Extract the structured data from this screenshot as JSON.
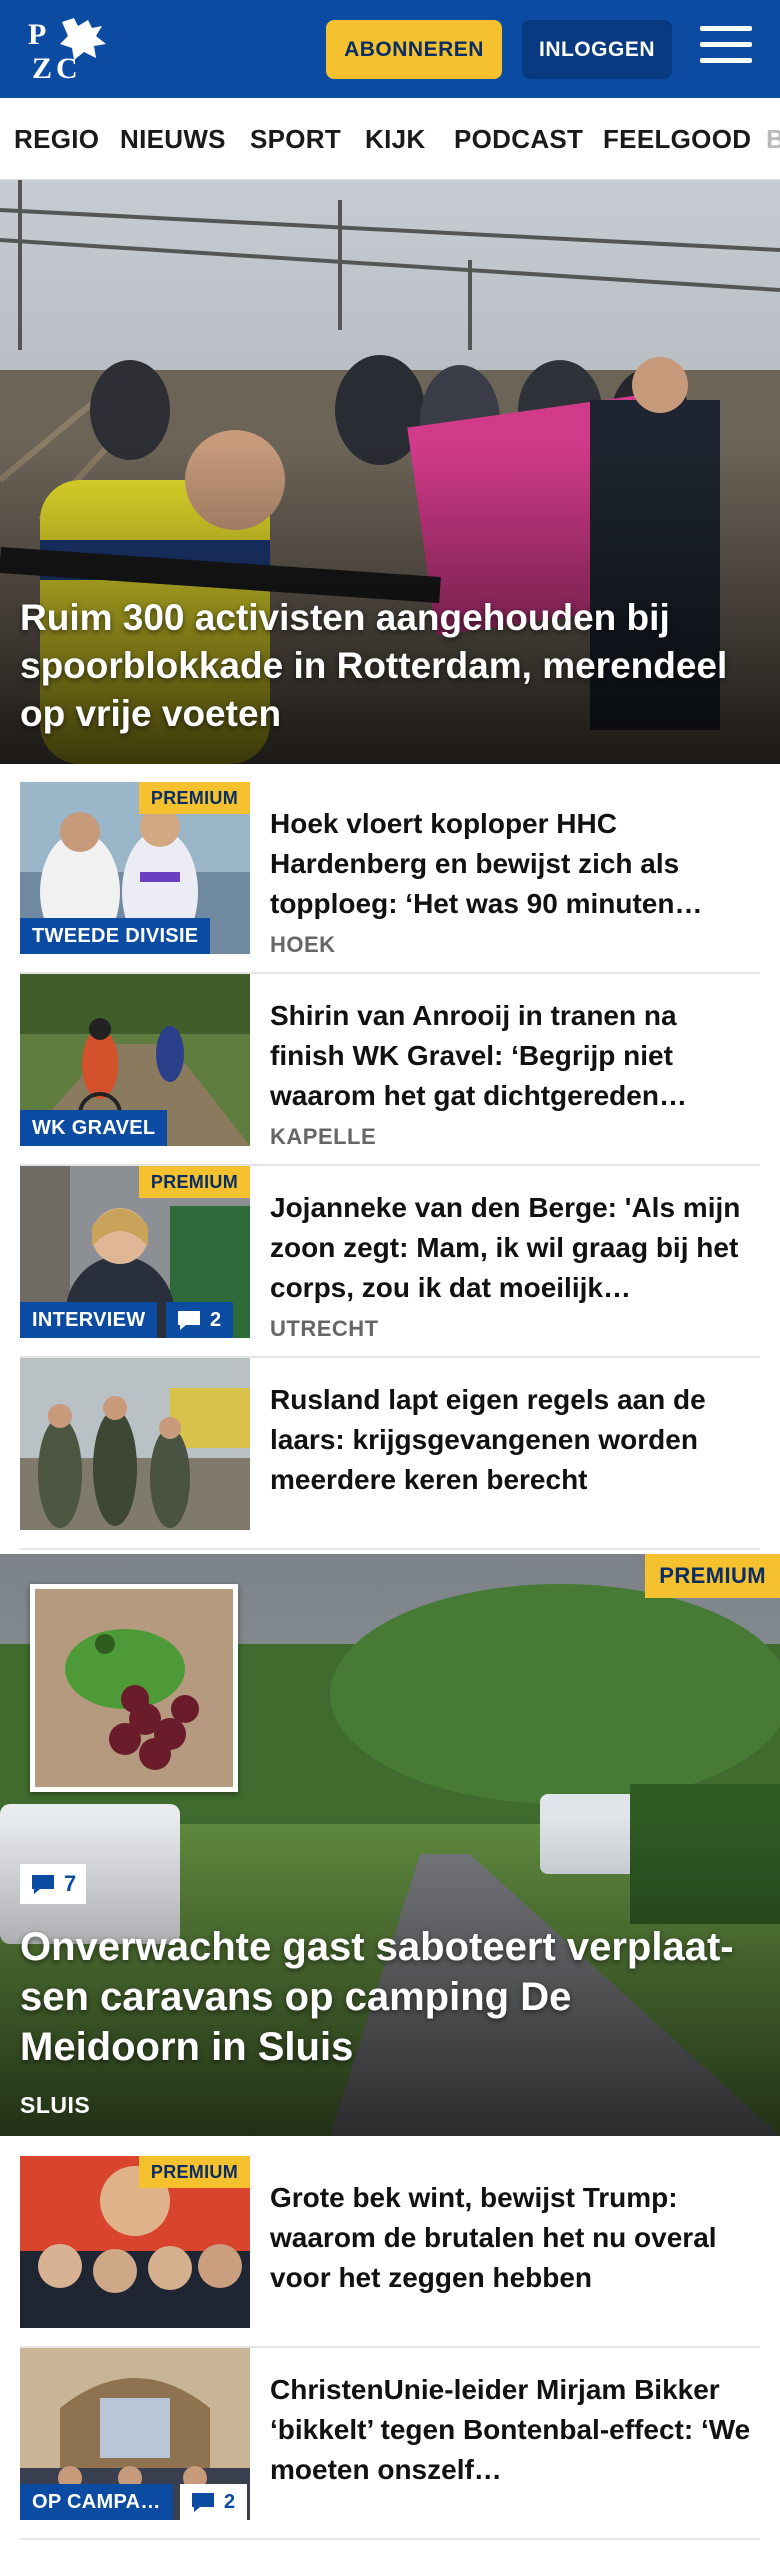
{
  "header": {
    "logo_text": "PZC",
    "subscribe_label": "ABONNEREN",
    "login_label": "INLOGGEN"
  },
  "colors": {
    "brand": "#0b4ba1",
    "accent": "#f6c12f"
  },
  "nav": {
    "items": [
      "REGIO",
      "NIEUWS",
      "SPORT",
      "KIJK",
      "PODCAST",
      "FEELGOOD",
      "B"
    ]
  },
  "hero": {
    "title": "Ruim 300 activisten aangehouden bij spoorblokkade in Rotterdam, merendeel op vrije voeten"
  },
  "articles": [
    {
      "premium": "PREMIUM",
      "category": "TWEEDE DIVISIE",
      "title": "Hoek vloert koploper HHC Hardenberg en bewijst zich als topploeg: ‘Het was 90 minuten…",
      "place": "HOEK"
    },
    {
      "category": "WK GRAVEL",
      "title": "Shirin van Anrooij in tranen na finish WK Gravel: ‘Begrijp niet waarom het gat dichtgereden…",
      "place": "KAPELLE"
    },
    {
      "premium": "PREMIUM",
      "category": "INTERVIEW",
      "comments": "2",
      "title": "Jojanneke van den Berge: 'Als mijn zoon zegt: Mam, ik wil graag bij het corps, zou ik dat moeilijk…",
      "place": "UTRECHT"
    },
    {
      "title": "Rusland lapt eigen regels aan de laars: krijgsgevangenen worden meerdere keren berecht"
    }
  ],
  "feature": {
    "premium": "PREMIUM",
    "comments": "7",
    "title": "Onverwachte gast saboteert verplaat­sen caravans op camping De Meidoorn in Sluis",
    "place": "SLUIS"
  },
  "articles2": [
    {
      "premium": "PREMIUM",
      "title": "Grote bek wint, bewijst Trump: waarom de brutalen het nu overal voor het zeggen hebben"
    },
    {
      "category": "OP CAMPA…",
      "comments": "2",
      "title": "ChristenUnie-leider Mirjam Bikker ‘bikkelt’ tegen Bontenbal-effect: ‘We moeten onszelf…"
    }
  ],
  "icons": {
    "menu": "hamburger-icon",
    "comment": "comment-icon",
    "logo": "pzc-logo-icon"
  }
}
